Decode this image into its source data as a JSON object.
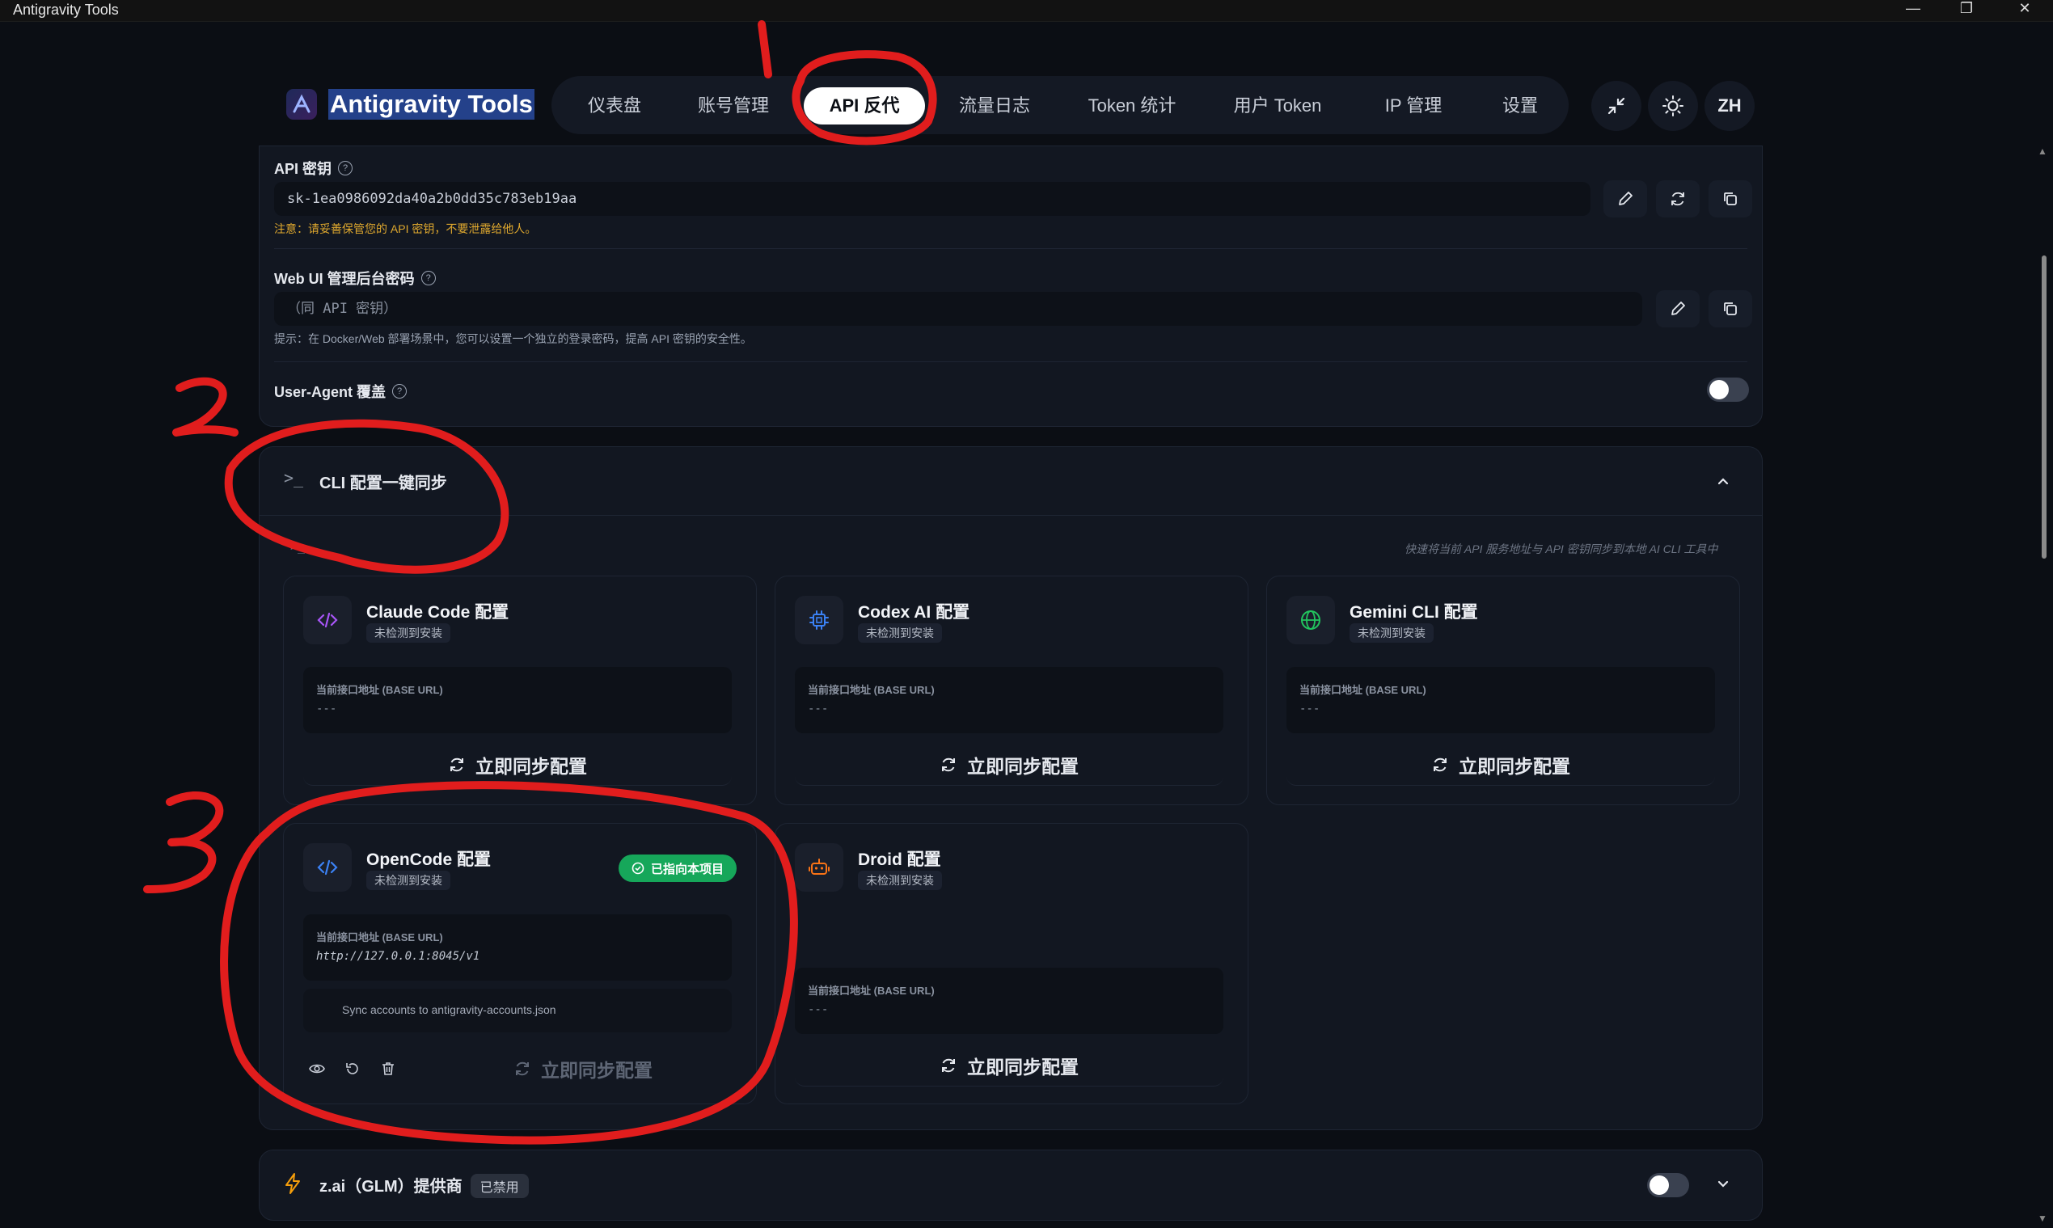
{
  "window": {
    "title": "Antigravity Tools",
    "controls": [
      "—",
      "❐",
      "✕"
    ]
  },
  "brand": {
    "name": "Antigravity Tools"
  },
  "tabs": [
    {
      "label": "仪表盘"
    },
    {
      "label": "账号管理"
    },
    {
      "label": "API 反代",
      "active": true
    },
    {
      "label": "流量日志"
    },
    {
      "label": "Token 统计"
    },
    {
      "label": "用户 Token"
    },
    {
      "label": "IP 管理"
    },
    {
      "label": "设置"
    }
  ],
  "header_actions": {
    "collapse_icon": "minimize-arrows-icon",
    "theme_icon": "sun-icon",
    "lang": "ZH"
  },
  "api_key": {
    "label": "API 密钥",
    "value": "sk-1ea0986092da40a2b0dd35c783eb19aa",
    "warning": "注意：请妥善保管您的 API 密钥，不要泄露给他人。"
  },
  "webui_password": {
    "label": "Web UI 管理后台密码",
    "placeholder": "（同 API 密钥）",
    "hint": "提示：在 Docker/Web 部署场景中，您可以设置一个独立的登录密码，提高 API 密钥的安全性。"
  },
  "user_agent": {
    "label": "User-Agent 覆盖",
    "enabled": false
  },
  "cli_sync": {
    "title": "CLI 配置一键同步",
    "caption": "快速将当前 API 服务地址与 API 密钥同步到本地 AI CLI 工具中",
    "url_label": "当前接口地址 (BASE URL)",
    "sync_label": "立即同步配置",
    "tools": [
      {
        "name": "Claude Code 配置",
        "status": "未检测到安装",
        "url": "---",
        "icon": "code-brackets-icon",
        "color": "#a855f7"
      },
      {
        "name": "Codex AI 配置",
        "status": "未检测到安装",
        "url": "---",
        "icon": "cpu-chip-icon",
        "color": "#3b82f6"
      },
      {
        "name": "Gemini CLI 配置",
        "status": "未检测到安装",
        "url": "---",
        "icon": "globe-icon",
        "color": "#22c55e"
      },
      {
        "name": "OpenCode 配置",
        "status": "未检测到安装",
        "url": "http://127.0.0.1:8045/v1",
        "icon": "code-brackets-icon",
        "color": "#3b82f6",
        "badge": "已指向本项目",
        "sync_accounts": "Sync accounts to antigravity-accounts.json"
      },
      {
        "name": "Droid 配置",
        "status": "未检测到安装",
        "url": "---",
        "icon": "robot-icon",
        "color": "#f97316"
      }
    ]
  },
  "zai": {
    "title": "z.ai（GLM）提供商",
    "badge": "已禁用",
    "enabled": false
  },
  "annotations": [
    "1",
    "2",
    "3"
  ]
}
